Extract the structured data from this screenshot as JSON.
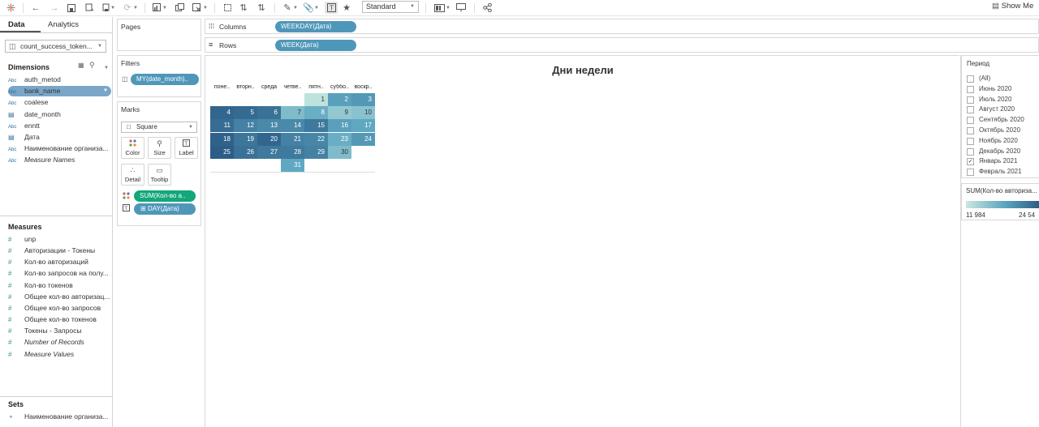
{
  "toolbar": {
    "standard": "Standard",
    "show_me": "Show Me"
  },
  "left": {
    "tabs": [
      "Data",
      "Analytics"
    ],
    "datasource": "count_success_token...",
    "dimensions_title": "Dimensions",
    "dimensions": [
      {
        "type": "Abc",
        "label": "auth_metod"
      },
      {
        "type": "Abc",
        "label": "bank_name"
      },
      {
        "type": "Abc",
        "label": "coalese"
      },
      {
        "type": "date",
        "label": "date_month"
      },
      {
        "type": "Abc",
        "label": "enntt"
      },
      {
        "type": "date",
        "label": "Дата"
      },
      {
        "type": "Abc",
        "label": "Наименование организа..."
      },
      {
        "type": "Abc",
        "label": "Measure Names"
      }
    ],
    "measures_title": "Measures",
    "measures": [
      {
        "label": "unp"
      },
      {
        "label": "Авторизации - Токены"
      },
      {
        "label": "Кол-во авторизаций"
      },
      {
        "label": "Кол-во запросов на полу..."
      },
      {
        "label": "Кол-во токенов"
      },
      {
        "label": "Общее кол-во авторизац..."
      },
      {
        "label": "Общее кол-во запросов"
      },
      {
        "label": "Общее кол-во токенов"
      },
      {
        "label": "Токены - Запросы"
      },
      {
        "label": "Number of Records"
      },
      {
        "label": "Measure Values"
      }
    ],
    "sets_title": "Sets",
    "sets": [
      {
        "label": "Наименование организа..."
      }
    ]
  },
  "shelves": {
    "pages": "Pages",
    "filters": "Filters",
    "filter_pill": "MY(date_month)..",
    "marks": "Marks",
    "mark_type": "Square",
    "mark_buttons": [
      "Color",
      "Size",
      "Label",
      "Detail",
      "Tooltip"
    ],
    "mark_pills": [
      "SUM(Кол-во а..",
      "DAY(Дата)"
    ],
    "columns_label": "Columns",
    "columns_pill": "WEEKDAY(Дата)",
    "rows_label": "Rows",
    "rows_pill": "WEEK(Дата)"
  },
  "filter_card": {
    "title": "Период",
    "items": [
      {
        "label": "(All)",
        "checked": false
      },
      {
        "label": "Июнь 2020",
        "checked": false
      },
      {
        "label": "Июль 2020",
        "checked": false
      },
      {
        "label": "Август 2020",
        "checked": false
      },
      {
        "label": "Сентябрь 2020",
        "checked": false
      },
      {
        "label": "Октябрь 2020",
        "checked": false
      },
      {
        "label": "Ноябрь 2020",
        "checked": false
      },
      {
        "label": "Декабрь 2020",
        "checked": false
      },
      {
        "label": "Январь 2021",
        "checked": true
      },
      {
        "label": "Февраль 2021",
        "checked": false
      }
    ]
  },
  "legend": {
    "title": "SUM(Кол-во авториза...",
    "min_label": "11 984",
    "max_label": "24 54",
    "color_low": "#c9e8df",
    "color_high": "#2a5a85"
  },
  "chart_data": {
    "type": "heatmap",
    "title": "Дни недели",
    "columns": [
      "поне..",
      "вторн..",
      "среда",
      "четве..",
      "пятн..",
      "суббо..",
      "воскр.."
    ],
    "weeks": [
      [
        null,
        null,
        null,
        null,
        1,
        2,
        3
      ],
      [
        4,
        5,
        6,
        7,
        8,
        9,
        10
      ],
      [
        11,
        12,
        13,
        14,
        15,
        16,
        17
      ],
      [
        18,
        19,
        20,
        21,
        22,
        23,
        24
      ],
      [
        25,
        26,
        27,
        28,
        29,
        30,
        null
      ],
      [
        null,
        null,
        null,
        31,
        null,
        null,
        null
      ]
    ],
    "color_values": [
      [
        null,
        null,
        null,
        null,
        0.05,
        0.55,
        0.6
      ],
      [
        0.92,
        0.9,
        0.85,
        0.35,
        0.45,
        0.25,
        0.3
      ],
      [
        0.88,
        0.75,
        0.7,
        0.7,
        0.8,
        0.55,
        0.5
      ],
      [
        0.95,
        0.82,
        0.92,
        0.75,
        0.72,
        0.45,
        0.6
      ],
      [
        0.98,
        0.85,
        0.8,
        0.8,
        0.75,
        0.35,
        null
      ],
      [
        null,
        null,
        null,
        0.5,
        null,
        null,
        null
      ]
    ]
  }
}
